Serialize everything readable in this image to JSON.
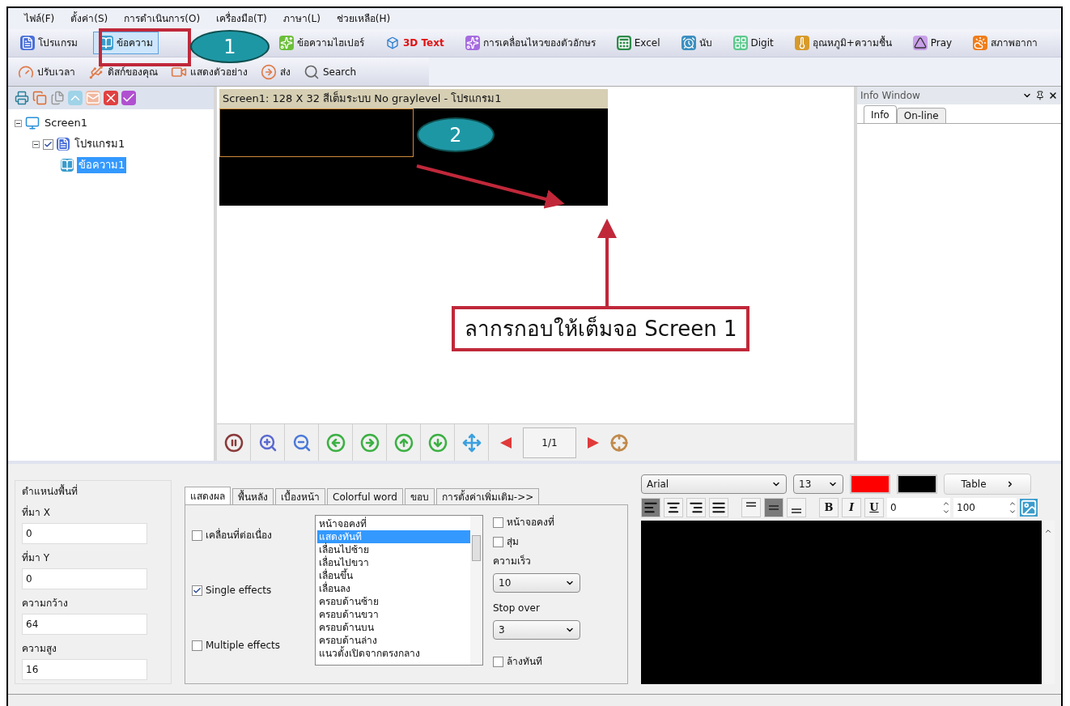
{
  "menu": [
    "ไฟล์(F)",
    "ตั้งค่า(S)",
    "การดำเนินการ(O)",
    "เครื่องมือ(T)",
    "ภาษา(L)",
    "ช่วยเหลือ(H)"
  ],
  "toolbar": [
    {
      "label": "โปรแกรม",
      "selected": false,
      "emphasized": false
    },
    {
      "label": "ข้อความ",
      "selected": true,
      "emphasized": false
    },
    {
      "label": "ข้อความไฮเปอร์",
      "selected": false,
      "emphasized": false
    },
    {
      "label": "3D Text",
      "selected": false,
      "emphasized": true
    },
    {
      "label": "การเคลื่อนไหวของตัวอักษร",
      "selected": false,
      "emphasized": false
    },
    {
      "label": "Excel",
      "selected": false,
      "emphasized": false
    },
    {
      "label": "นับ",
      "selected": false,
      "emphasized": false
    },
    {
      "label": "Digit",
      "selected": false,
      "emphasized": false
    },
    {
      "label": "อุณหภูมิ+ความชื้น",
      "selected": false,
      "emphasized": false
    },
    {
      "label": "Pray",
      "selected": false,
      "emphasized": false
    },
    {
      "label": "สภาพอากา",
      "selected": false,
      "emphasized": false
    }
  ],
  "toolbar2": [
    "ปรับเวลา",
    "ดิสก์ของคุณ",
    "แสดงตัวอย่าง",
    "ส่ง",
    "Search"
  ],
  "tree": [
    {
      "label": "Screen1",
      "expanded": true,
      "selected": false,
      "children": [
        {
          "label": "โปรแกรม1",
          "expanded": true,
          "checked": true,
          "selected": false,
          "children": [
            {
              "label": "ข้อความ1",
              "selected": true
            }
          ]
        }
      ]
    }
  ],
  "canvas": {
    "title": "Screen1: 128 X 32  สีเต็มระบบ  No graylevel - โปรแกรม1"
  },
  "annotations": {
    "markers": [
      "1",
      "2"
    ],
    "note": "ลากรกอบให้เต็มจอ Screen 1"
  },
  "navigator": {
    "page": "1/1"
  },
  "info_window": {
    "title": "Info Window",
    "tabs": [
      {
        "label": "Info",
        "selected": true
      },
      {
        "label": "On-line",
        "selected": false
      }
    ]
  },
  "area": {
    "title": "ตำแหน่งพื้นที่",
    "fields": [
      {
        "label": "ที่มา X",
        "value": "0"
      },
      {
        "label": "ที่มา Y",
        "value": "0"
      },
      {
        "label": "ความกว้าง",
        "value": "64"
      },
      {
        "label": "ความสูง",
        "value": "16"
      }
    ]
  },
  "effects": {
    "tabs": [
      {
        "label": "แสดงผล",
        "selected": true
      },
      {
        "label": "พื้นหลัง",
        "selected": false
      },
      {
        "label": "เบื้องหน้า",
        "selected": false
      },
      {
        "label": "Colorful word",
        "selected": false
      },
      {
        "label": "ขอบ",
        "selected": false
      },
      {
        "label": "การตั้งค่าเพิ่มเติม->>",
        "selected": false
      }
    ],
    "modes": [
      {
        "label": "เคลื่อนที่ต่อเนื่อง",
        "checked": false
      },
      {
        "label": "Single effects",
        "checked": true
      },
      {
        "label": "Multiple effects",
        "checked": false
      }
    ],
    "list": [
      {
        "label": "หน้าจอคงที่",
        "selected": false
      },
      {
        "label": "แสดงทันที",
        "selected": true
      },
      {
        "label": "เลื่อนไปซ้าย",
        "selected": false
      },
      {
        "label": "เลื่อนไปขวา",
        "selected": false
      },
      {
        "label": "เลื่อนขึ้น",
        "selected": false
      },
      {
        "label": "เลื่อนลง",
        "selected": false
      },
      {
        "label": "ครอบด้านซ้าย",
        "selected": false
      },
      {
        "label": "ครอบด้านขวา",
        "selected": false
      },
      {
        "label": "ครอบด้านบน",
        "selected": false
      },
      {
        "label": "ครอบด้านล่าง",
        "selected": false
      },
      {
        "label": "แนวตั้งเปิดจากตรงกลาง",
        "selected": false
      }
    ],
    "fixed_screen": {
      "label": "หน้าจอคงที่",
      "checked": false
    },
    "random": {
      "label": "สุ่ม",
      "checked": false
    },
    "speed": {
      "label": "ความเร็ว",
      "value": "10"
    },
    "stop_over": {
      "label": "Stop over",
      "value": "3"
    },
    "clear_now": {
      "label": "ล้างทันที",
      "checked": false
    }
  },
  "text_editor": {
    "font": "Arial",
    "size": "13",
    "swatches": [
      {
        "color": "#ff0000"
      },
      {
        "color": "#000000"
      }
    ],
    "table_button": "Table",
    "align": [
      {
        "selected": true
      },
      {
        "selected": false
      },
      {
        "selected": false
      },
      {
        "selected": false
      }
    ],
    "valign": [
      {
        "selected": false
      },
      {
        "selected": true
      },
      {
        "selected": false
      }
    ],
    "styles": [
      "B",
      "I",
      "U"
    ],
    "spin1": "0",
    "spin2": "100"
  }
}
